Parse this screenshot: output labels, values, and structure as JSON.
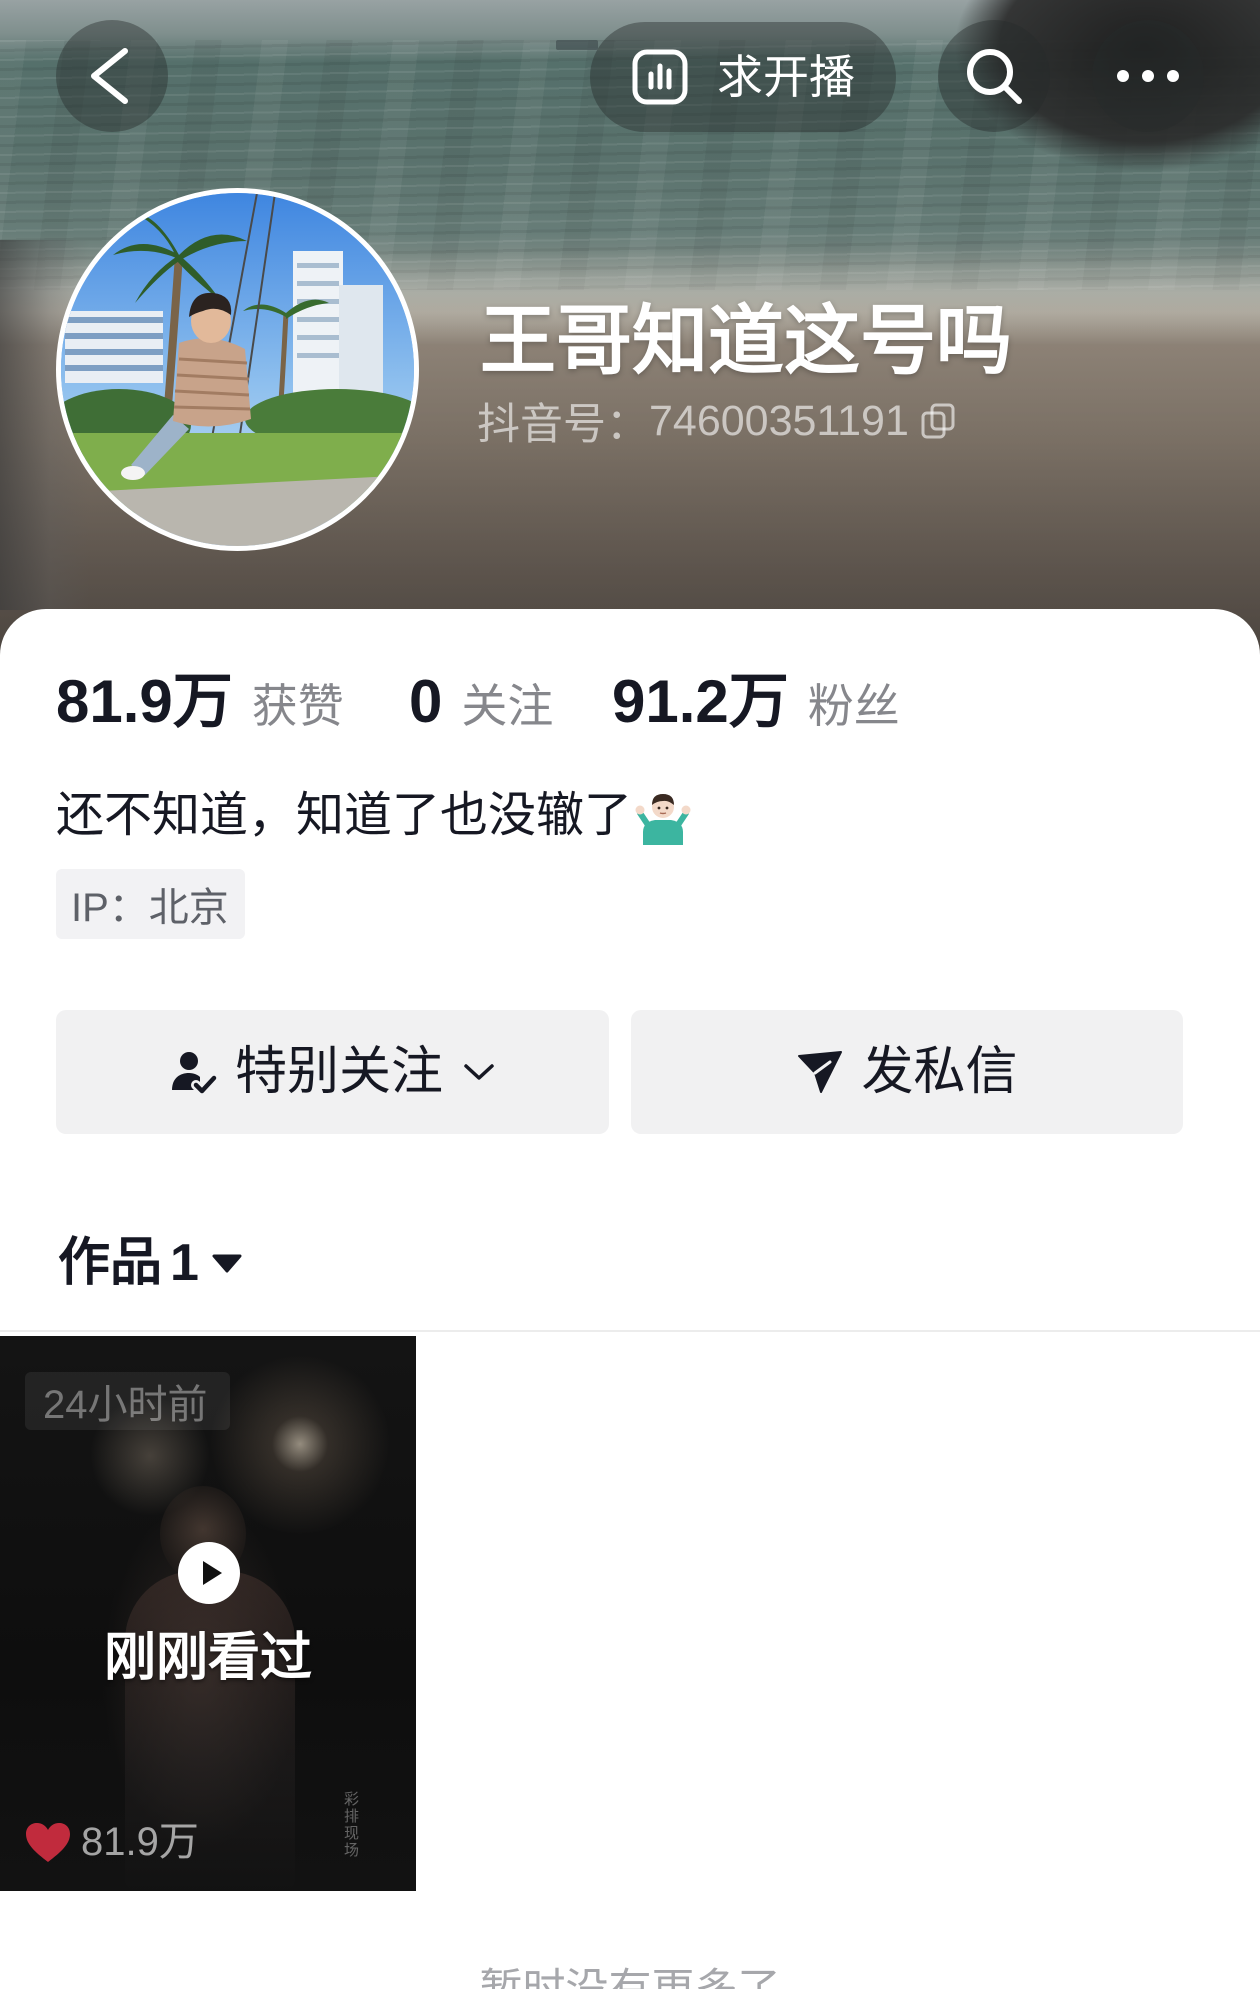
{
  "header": {
    "back_icon": "chevron-left-icon",
    "live_request": {
      "icon": "bar-chart-icon",
      "label": "求开播"
    },
    "search_icon": "search-icon",
    "more_icon": "more-dots-icon"
  },
  "profile": {
    "name": "王哥知道这号吗",
    "douyin_id_label": "抖音号：",
    "douyin_id": "74600351191",
    "copy_icon": "copy-icon"
  },
  "stats": [
    {
      "value": "81.9万",
      "label": "获赞"
    },
    {
      "value": "0",
      "label": "关注"
    },
    {
      "value": "91.2万",
      "label": "粉丝"
    }
  ],
  "bio": {
    "text": "还不知道，知道了也没辙了",
    "emoji_icon": "man-shrugging-emoji"
  },
  "ip_tag": "IP：北京",
  "actions": {
    "follow": {
      "label": "特别关注",
      "icon": "user-check-icon",
      "caret": "chevron-down-icon"
    },
    "message": {
      "label": "发私信",
      "icon": "send-icon"
    }
  },
  "works_tab": {
    "label": "作品",
    "count": "1",
    "caret": "triangle-down-icon"
  },
  "videos": [
    {
      "time_badge": "24小时前",
      "overlay_label": "刚刚看过",
      "likes": "81.9万",
      "watermark": "彩排现场",
      "play_icon": "play-icon",
      "like_icon": "heart-icon"
    }
  ],
  "footer_text": "暂时没有更多了",
  "colors": {
    "primary_text": "#161823",
    "secondary_text": "#86878c",
    "button_bg": "#f1f1f2",
    "like_red": "#e03045"
  }
}
